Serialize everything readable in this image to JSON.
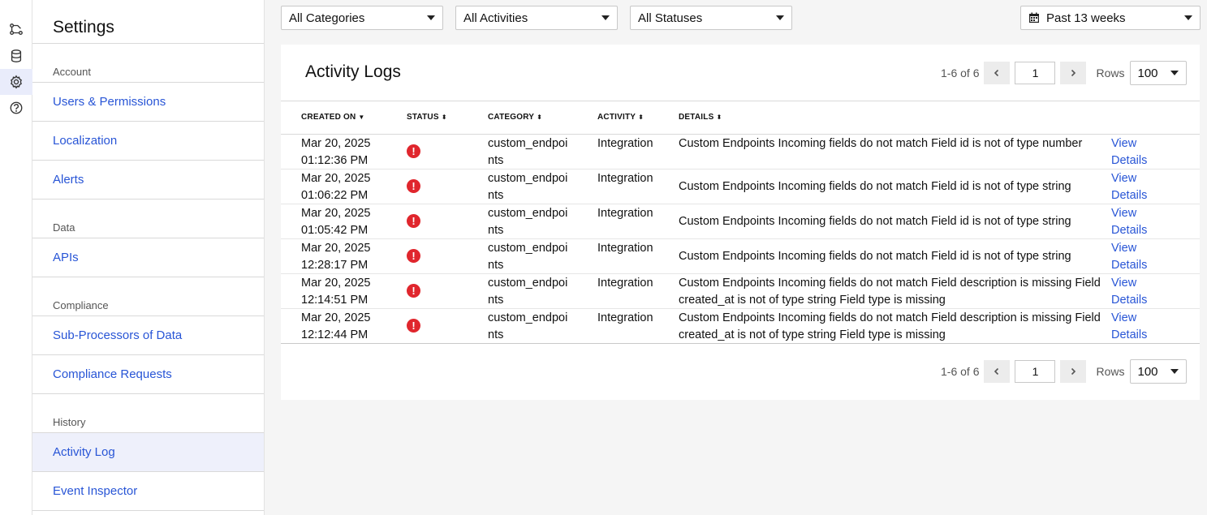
{
  "rail": [
    {
      "name": "workflow-icon"
    },
    {
      "name": "database-icon"
    },
    {
      "name": "gear-icon"
    },
    {
      "name": "help-icon"
    }
  ],
  "settings": {
    "title": "Settings",
    "sections": {
      "account": "Account",
      "data": "Data",
      "compliance": "Compliance",
      "history": "History"
    },
    "items": {
      "users": "Users & Permissions",
      "localization": "Localization",
      "alerts": "Alerts",
      "apis": "APIs",
      "subprocessors": "Sub-Processors of Data",
      "compliance_requests": "Compliance Requests",
      "activity_log": "Activity Log",
      "event_inspector": "Event Inspector"
    }
  },
  "filters": {
    "categories": "All Categories",
    "activities": "All Activities",
    "statuses": "All Statuses",
    "range": "Past 13 weeks"
  },
  "card": {
    "title": "Activity Logs",
    "pager": {
      "count": "1-6 of 6",
      "page": "1",
      "rows_label": "Rows",
      "rows": "100"
    }
  },
  "table": {
    "headers": {
      "created_on": "CREATED ON",
      "status": "STATUS",
      "category": "CATEGORY",
      "activity": "ACTIVITY",
      "details": "DETAILS"
    },
    "view_details": "View Details",
    "status_icon": "error-icon",
    "status_color": "#e0262d",
    "rows": [
      {
        "date": "Mar 20, 2025 01:12:36 PM",
        "category": "custom_endpoints",
        "activity": "Integration",
        "details": "Custom Endpoints Incoming fields do not match Field id is not of type number"
      },
      {
        "date": "Mar 20, 2025 01:06:22 PM",
        "category": "custom_endpoints",
        "activity": "Integration",
        "details": "Custom Endpoints Incoming fields do not match Field id is not of type string"
      },
      {
        "date": "Mar 20, 2025 01:05:42 PM",
        "category": "custom_endpoints",
        "activity": "Integration",
        "details": "Custom Endpoints Incoming fields do not match Field id is not of type string"
      },
      {
        "date": "Mar 20, 2025 12:28:17 PM",
        "category": "custom_endpoints",
        "activity": "Integration",
        "details": "Custom Endpoints Incoming fields do not match Field id is not of type string"
      },
      {
        "date": "Mar 20, 2025 12:14:51 PM",
        "category": "custom_endpoints",
        "activity": "Integration",
        "details": "Custom Endpoints Incoming fields do not match Field description is missing Field created_at is not of type string Field type is missing"
      },
      {
        "date": "Mar 20, 2025 12:12:44 PM",
        "category": "custom_endpoints",
        "activity": "Integration",
        "details": "Custom Endpoints Incoming fields do not match Field description is missing Field created_at is not of type string Field type is missing"
      }
    ]
  },
  "colors": {
    "link": "#2855d6",
    "active_nav_bg": "#eef0fb",
    "error": "#e0262d"
  }
}
